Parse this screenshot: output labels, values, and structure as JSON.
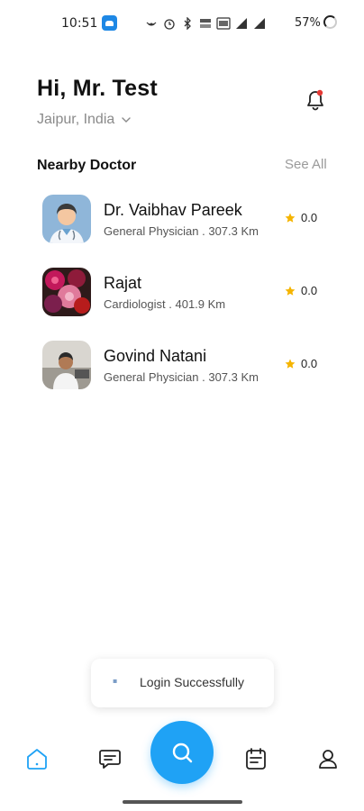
{
  "status_bar": {
    "time": "10:51",
    "battery_percent": "57%",
    "icons": [
      "app-notification-icon",
      "hotspot-icon",
      "alarm-icon",
      "bluetooth-icon",
      "data-speed-icon",
      "volte-icon",
      "signal-icon",
      "signal-4g-icon",
      "battery-icon"
    ]
  },
  "header": {
    "greeting": "Hi, Mr. Test",
    "location": "Jaipur, India",
    "bell_badge_color": "#e53935"
  },
  "nearby": {
    "title": "Nearby Doctor",
    "see_all": "See All",
    "doctors": [
      {
        "name": "Dr. Vaibhav Pareek",
        "meta": "General Physician . 307.3 Km",
        "rating": "0.0",
        "avatar": "doctor-illustration"
      },
      {
        "name": "Rajat",
        "meta": "Cardiologist . 401.9 Km",
        "rating": "0.0",
        "avatar": "flowers-photo"
      },
      {
        "name": "Govind Natani",
        "meta": "General Physician . 307.3 Km",
        "rating": "0.0",
        "avatar": "man-photo"
      }
    ]
  },
  "toast": {
    "text": "Login Successfully"
  },
  "bottom_nav": {
    "items": [
      "home-icon",
      "chat-icon",
      "search-icon",
      "calendar-icon",
      "profile-icon"
    ],
    "active": "home-icon",
    "accent": "#1fa2f5"
  }
}
